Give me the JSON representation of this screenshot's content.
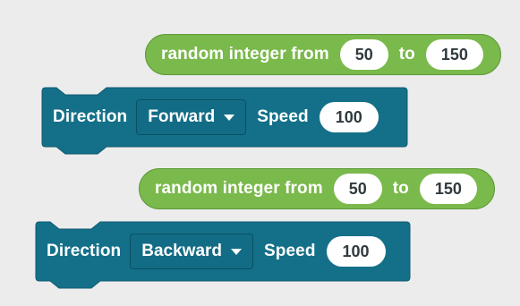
{
  "colors": {
    "background": "#ececec",
    "reporter_block": "#7ab94b",
    "command_block": "#147089",
    "field_fill": "#ffffff",
    "field_text": "#2f3a3e"
  },
  "blocks": [
    {
      "type": "reporter",
      "label_prefix": "random integer from",
      "from_value": "50",
      "label_to": "to",
      "to_value": "150"
    },
    {
      "type": "command",
      "direction_label": "Direction",
      "direction_value": "Forward",
      "speed_label": "Speed",
      "speed_value": "100",
      "dropdown_icon": "caret-down-icon"
    },
    {
      "type": "reporter",
      "label_prefix": "random integer from",
      "from_value": "50",
      "label_to": "to",
      "to_value": "150"
    },
    {
      "type": "command",
      "direction_label": "Direction",
      "direction_value": "Backward",
      "speed_label": "Speed",
      "speed_value": "100",
      "dropdown_icon": "caret-down-icon"
    }
  ]
}
